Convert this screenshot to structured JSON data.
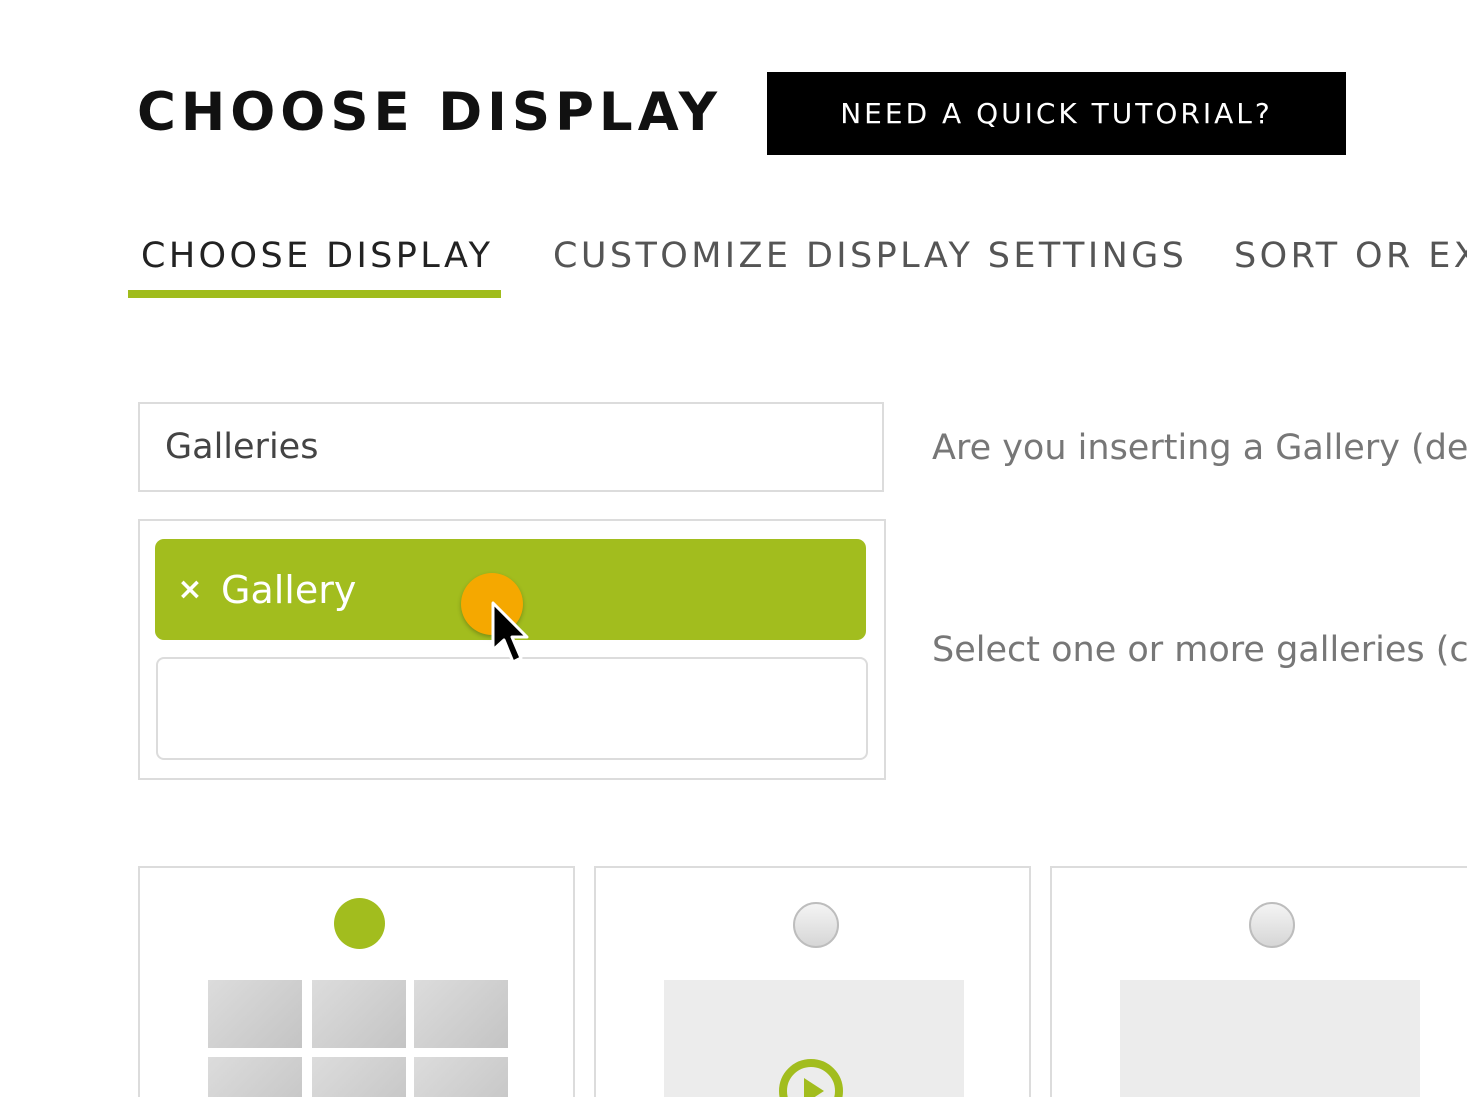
{
  "header": {
    "title": "CHOOSE DISPLAY",
    "tutorial_button": "NEED A QUICK TUTORIAL?"
  },
  "tabs": [
    {
      "label": "CHOOSE DISPLAY",
      "active": true
    },
    {
      "label": "CUSTOMIZE DISPLAY SETTINGS",
      "active": false
    },
    {
      "label": "SORT OR EX",
      "active": false
    }
  ],
  "source": {
    "selected": "Galleries",
    "help": "Are you inserting a Gallery (de"
  },
  "galleries": {
    "chips": [
      {
        "label": "Gallery",
        "remove_icon": "×"
      }
    ],
    "input_value": "",
    "help": "Select one or more galleries (c"
  },
  "display_types": [
    {
      "icon": "thumbnail-grid-icon",
      "selected": true
    },
    {
      "icon": "slideshow-play-icon",
      "selected": false
    },
    {
      "icon": "image-browser-icon",
      "selected": false
    }
  ],
  "colors": {
    "accent": "#a2bd1e",
    "cursor_highlight": "#f5a800",
    "button_bg": "#000000"
  }
}
